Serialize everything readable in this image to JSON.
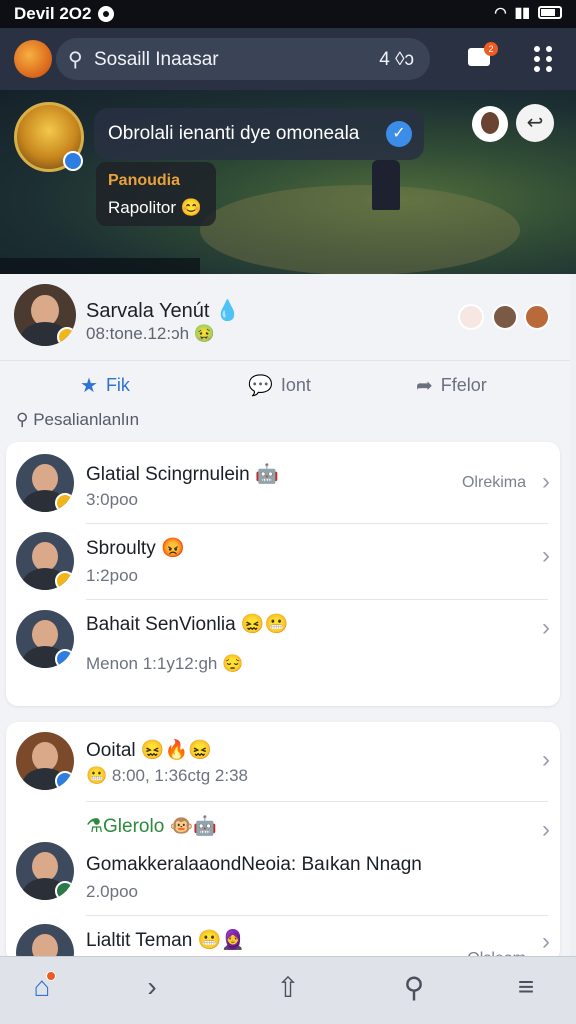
{
  "status": {
    "time": "Devil 2O2",
    "signal_icon": "wifi-icon",
    "battery_icon": "battery-icon"
  },
  "topbar": {
    "search_text": "Sosaill Inaasar",
    "search_right": "4 ◊ᴐ",
    "messages_badge": "2"
  },
  "banner": {
    "bubble_text": "Obrolali ienanti dye omoneala",
    "verified_icon": "✓",
    "card_line1": "Panoudia",
    "card_line2": "Rapolitor 😊",
    "reply_icon": "↩"
  },
  "profile": {
    "name": "Sarvala Yenút 💧",
    "subtitle": "08:tone.12:ɔh 🤢"
  },
  "actions": [
    {
      "label": "Fik",
      "icon": "★"
    },
    {
      "label": "Iont",
      "icon": "💬"
    },
    {
      "label": "Ffelor",
      "icon": "➦"
    }
  ],
  "search2": "Pesalianlanlın",
  "list1": [
    {
      "title": "Glatial Scingrnulein 🤖",
      "meta": "3:0poo",
      "right": "Olrekima",
      "badge": "#f2b61b"
    },
    {
      "title": "Sbroulty 😡",
      "meta": "1:2poo",
      "right": "",
      "badge": "#f2b61b"
    },
    {
      "title": "Bahait SenVionlia 😖😬",
      "meta": "Menon 1:1y12:gh 😔",
      "right": "",
      "badge": "#2d7ee0"
    }
  ],
  "list2": [
    {
      "title": "Ooital 😖🔥😖",
      "meta": "😬 8:00, 1:36ctg 2:38",
      "right": "",
      "badge": "#2d7ee0"
    },
    {
      "title": "⚗Glerolo 🐵🤖",
      "meta": "",
      "right": "",
      "badge": ""
    },
    {
      "title": "GomakkeralaaondNeoia: Baıkan Nnagn",
      "meta": "2.0poo",
      "right": "",
      "badge": "#2a7a4a"
    },
    {
      "title": "Lialtit Teman 😬🧕",
      "meta": "",
      "right": "Olsleom",
      "badge": ""
    }
  ],
  "tabbar": {
    "home_badge": "",
    "tabs": [
      "home-icon",
      "forward-icon",
      "share-icon",
      "search-icon",
      "menu-icon"
    ]
  },
  "colors": {
    "accent": "#2d74d6",
    "dark": "#2a3142",
    "badge": "#ef5a22"
  }
}
